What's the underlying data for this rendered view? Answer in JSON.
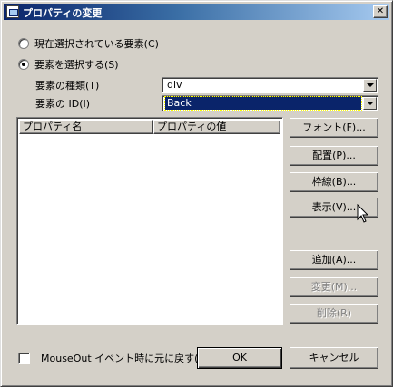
{
  "window": {
    "title": "プロパティの変更",
    "close_glyph": "✕"
  },
  "target": {
    "options": [
      {
        "label": "現在選択されている要素(C)",
        "checked": false
      },
      {
        "label": "要素を選択する(S)",
        "checked": true
      }
    ],
    "element_type_label": "要素の種類(T)",
    "element_type_value": "div",
    "element_id_label": "要素の ID(I)",
    "element_id_value": "Back"
  },
  "properties": {
    "columns": [
      "プロパティ名",
      "プロパティの値"
    ],
    "rows": []
  },
  "buttons": {
    "font": "フォント(F)...",
    "layout": "配置(P)...",
    "border": "枠線(B)...",
    "display": "表示(V)...",
    "add": "追加(A)...",
    "change": "変更(M)...",
    "delete": "削除(R)",
    "ok": "OK",
    "cancel": "キャンセル"
  },
  "options": {
    "mouseout_restore_label": "MouseOut イベント時に元に戻す(E)",
    "mouseout_restore_checked": false
  },
  "colors": {
    "face": "#d4d0c8",
    "title_active": "#0a246a",
    "selection": "#0a246a",
    "disabled_text": "#808080"
  },
  "icons": {
    "app": "window-icon",
    "close": "close-icon",
    "dropdown": "chevron-down-icon",
    "cursor": "mouse-pointer-icon"
  }
}
